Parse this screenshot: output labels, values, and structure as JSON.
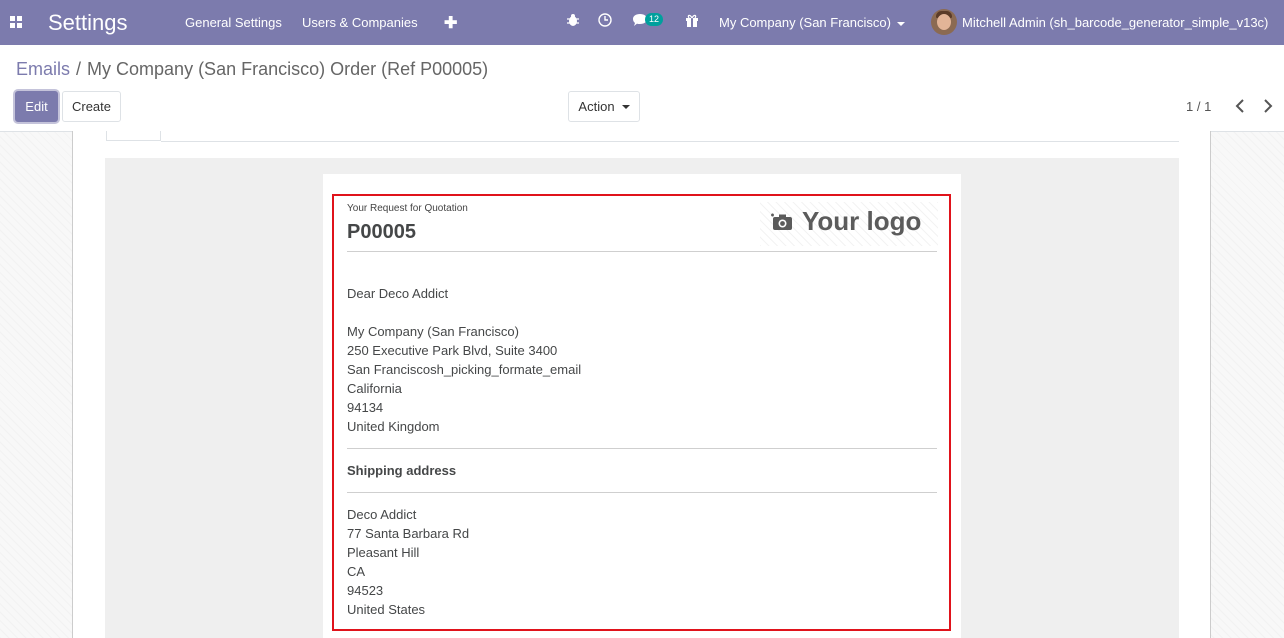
{
  "navbar": {
    "app_title": "Settings",
    "menu": [
      "General Settings",
      "Users & Companies"
    ],
    "messages_count": "12",
    "company": "My Company (San Francisco)",
    "user": "Mitchell Admin (sh_barcode_generator_simple_v13c)",
    "icons": [
      "apps-icon",
      "plus-icon",
      "bug-icon",
      "clock-icon",
      "chat-icon",
      "gift-icon"
    ],
    "bg_color": "#7c7bad"
  },
  "breadcrumb": {
    "parent": "Emails",
    "separator": "/",
    "current": "My Company (San Francisco) Order (Ref P00005)"
  },
  "control_panel": {
    "edit_label": "Edit",
    "create_label": "Create",
    "action_label": "Action",
    "pager": "1 / 1"
  },
  "email": {
    "intro": "Your Request for Quotation",
    "reference": "P00005",
    "logo_text": "Your logo",
    "greeting": "Dear Deco Addict",
    "company_address": [
      "My Company (San Francisco)",
      "250 Executive Park Blvd, Suite 3400",
      "San Franciscosh_picking_formate_email",
      "California",
      "94134",
      "United Kingdom"
    ],
    "shipping_heading": "Shipping address",
    "shipping_address": [
      "Deco Addict",
      "77 Santa Barbara Rd",
      "Pleasant Hill",
      "CA",
      "94523",
      "United States"
    ],
    "highlight_color": "#e0131b"
  }
}
